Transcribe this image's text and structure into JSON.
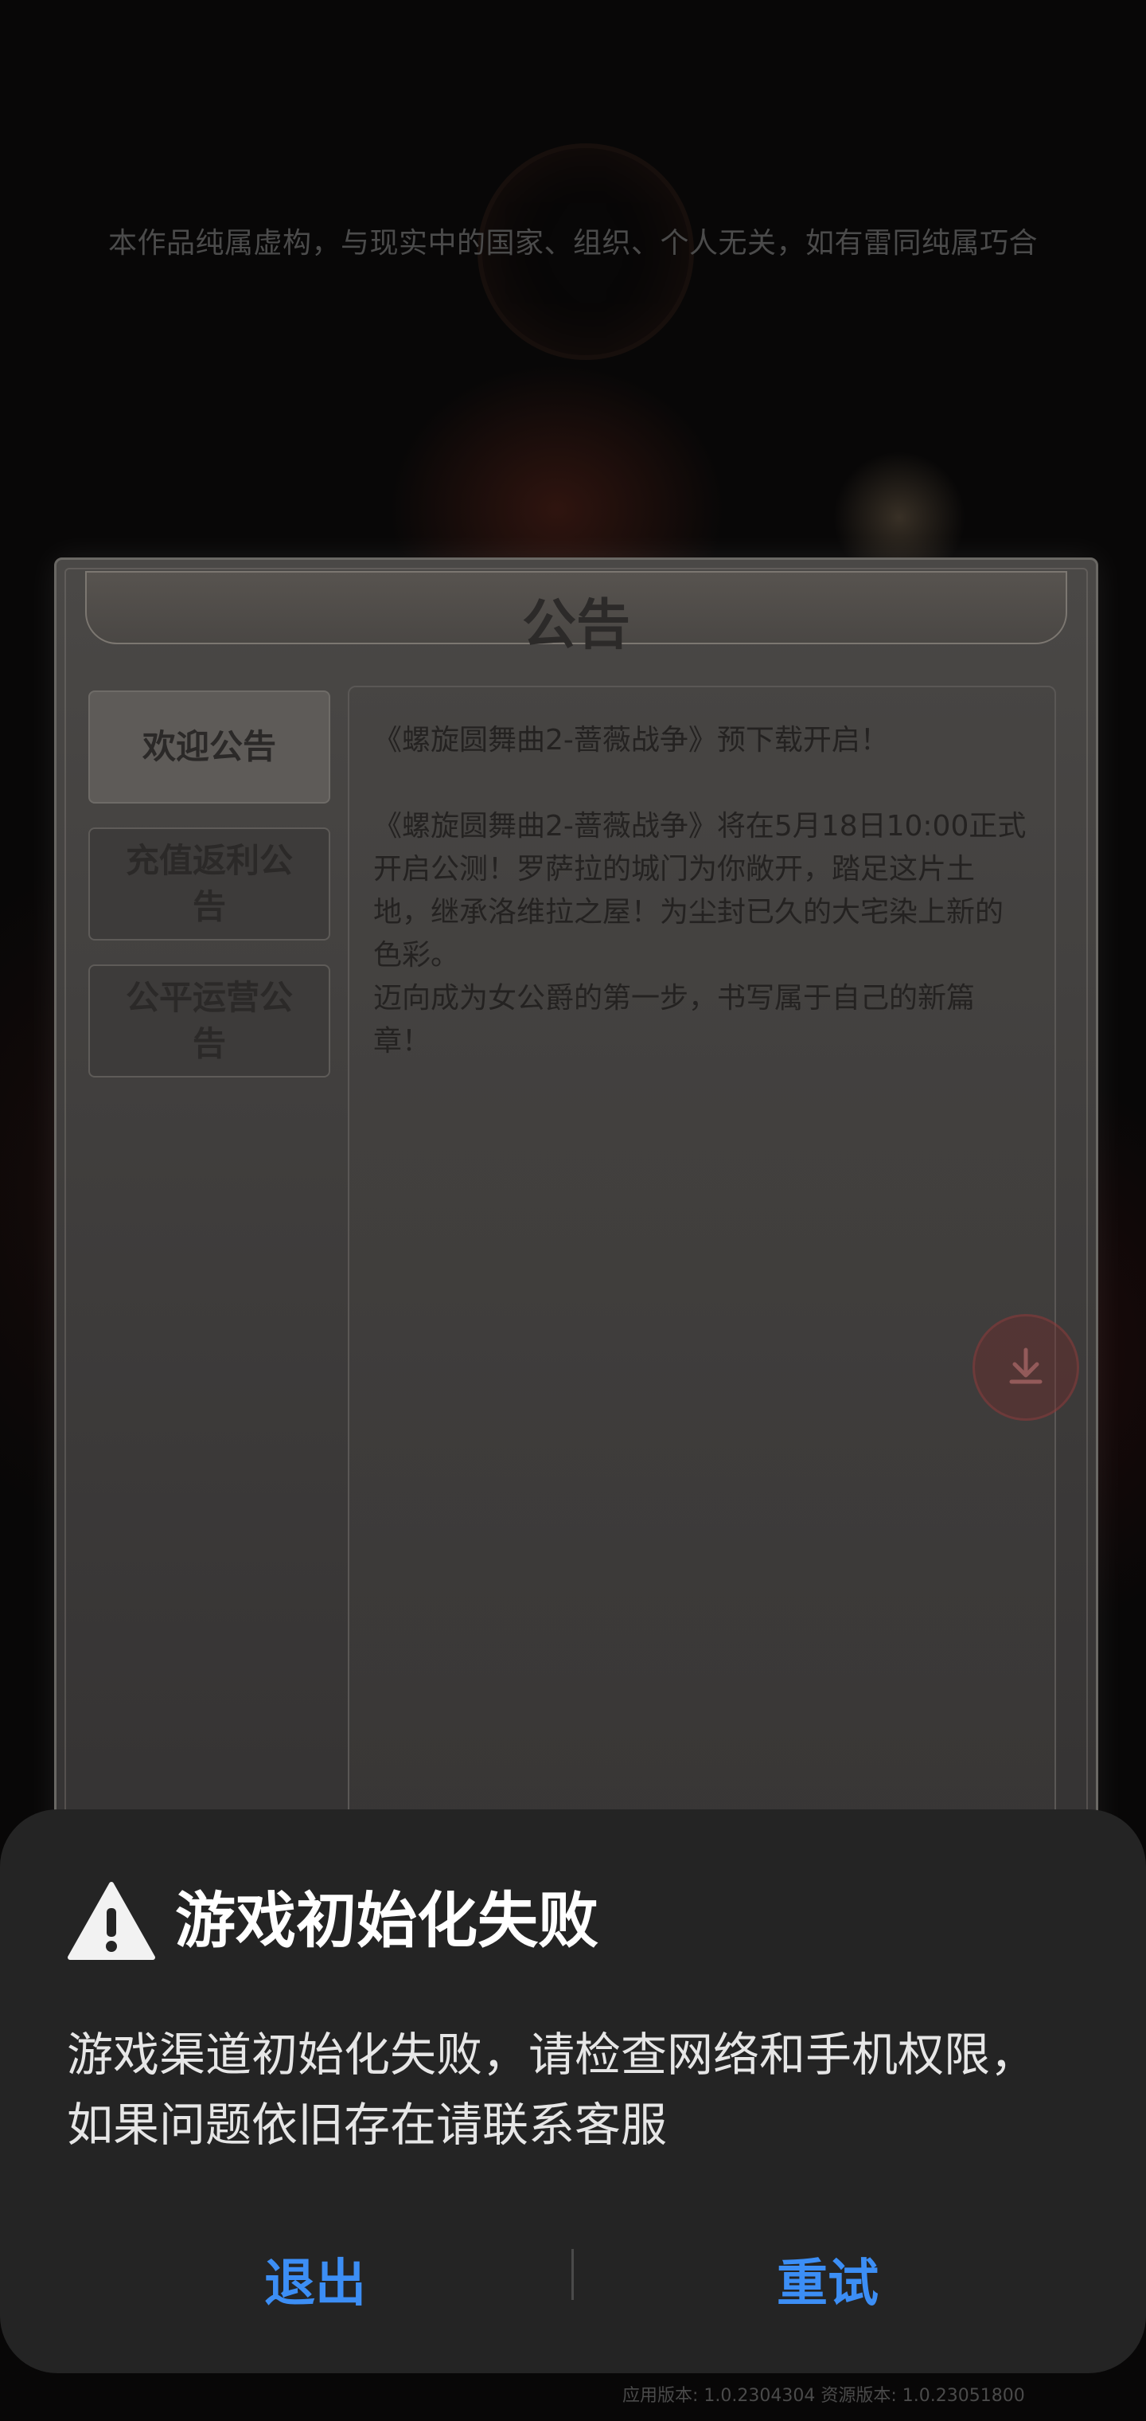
{
  "disclaimer": "本作品纯属虚构，与现实中的国家、组织、个人无关，如有雷同纯属巧合",
  "notice": {
    "title": "公告",
    "tabs": [
      {
        "label": "欢迎公告",
        "active": true
      },
      {
        "label": "充值返利公告",
        "active": false
      },
      {
        "label": "公平运营公告",
        "active": false
      }
    ],
    "content": {
      "headline": "《螺旋圆舞曲2-蔷薇战争》预下载开启！",
      "paragraph_1": "《螺旋圆舞曲2-蔷薇战争》将在5月18日10:00正式开启公测！罗萨拉的城门为你敞开，踏足这片土地，继承洛维拉之屋！为尘封已久的大宅染上新的色彩。",
      "paragraph_2": "迈向成为女公爵的第一步，书写属于自己的新篇章！"
    }
  },
  "dialog": {
    "icon": "warning-icon",
    "title": "游戏初始化失败",
    "message": "游戏渠道初始化失败，请检查网络和手机权限，如果问题依旧存在请联系客服",
    "buttons": {
      "exit": "退出",
      "retry": "重试"
    },
    "accent_color": "#3c8ef5"
  },
  "version": "应用版本: 1.0.2304304 资源版本: 1.0.23051800"
}
